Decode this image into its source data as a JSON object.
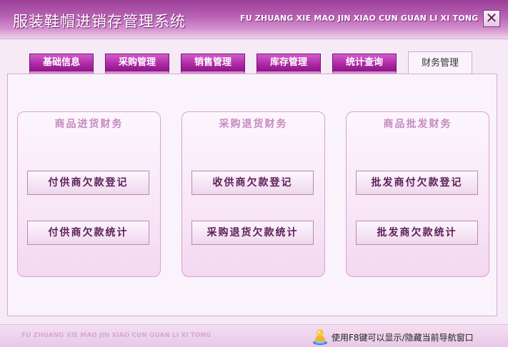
{
  "window": {
    "title": "服装鞋帽进销存管理系统",
    "title_pinyin": "FU ZHUANG XIE MAO JIN XIAO CUN GUAN LI XI TONG",
    "close_glyph": "✕"
  },
  "tabs": [
    {
      "label": "基础信息",
      "active": false
    },
    {
      "label": "采购管理",
      "active": false
    },
    {
      "label": "销售管理",
      "active": false
    },
    {
      "label": "库存管理",
      "active": false
    },
    {
      "label": "统计查询",
      "active": false
    },
    {
      "label": "财务管理",
      "active": true
    }
  ],
  "groups": [
    {
      "title": "商品进货财务",
      "buttons": [
        "付供商欠款登记",
        "付供商欠款统计"
      ]
    },
    {
      "title": "采购退货财务",
      "buttons": [
        "收供商欠款登记",
        "采购退货欠款统计"
      ]
    },
    {
      "title": "商品批发财务",
      "buttons": [
        "批发商付欠款登记",
        "批发商欠款统计"
      ]
    }
  ],
  "footer": {
    "pinyin": "FU ZHUANG XIE MAO JIN XIAO CUN GUAN LI XI TONG",
    "hint": "使用F8键可以显示/隐藏当前导航窗口",
    "hint_icon": "user-hint-icon"
  },
  "colors": {
    "title_bar": "#b65fb2",
    "tab": "#b02aa8",
    "group_title": "#c58ac1",
    "button_text": "#5a1f57"
  }
}
